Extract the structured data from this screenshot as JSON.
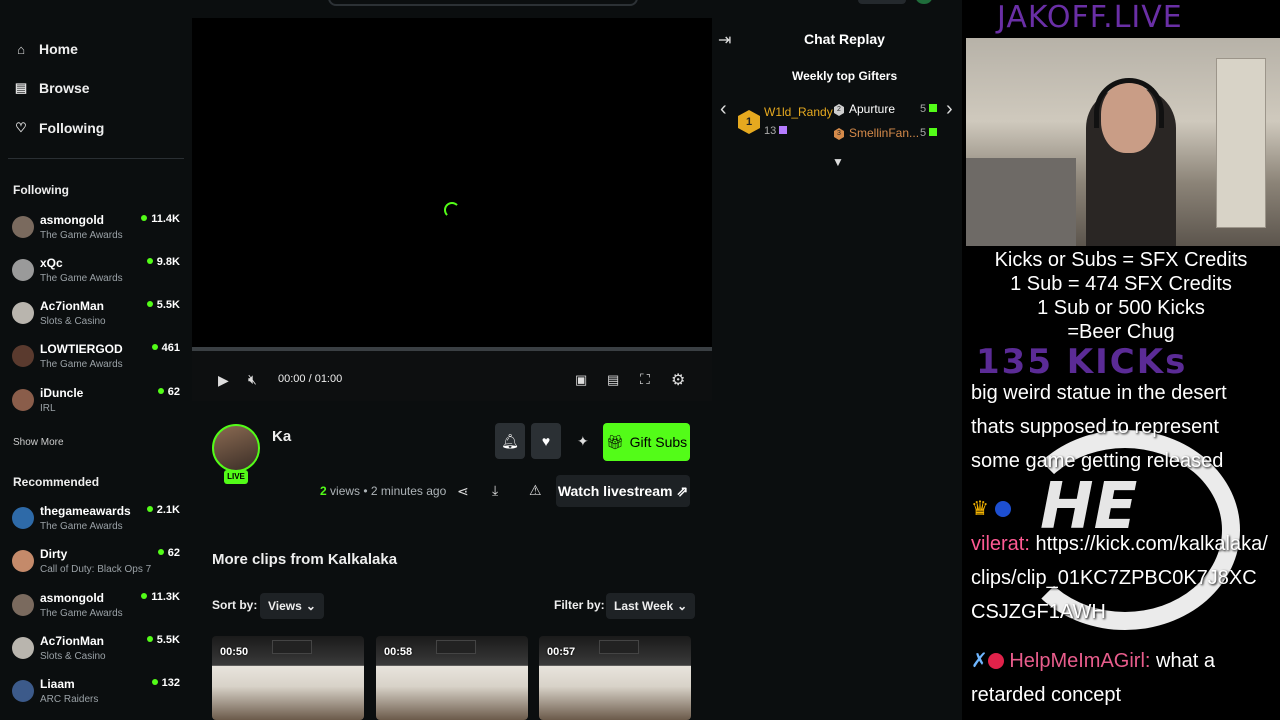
{
  "nav": [
    {
      "icon": "home-icon",
      "glyph": "⌂",
      "label": "Home"
    },
    {
      "icon": "browse-icon",
      "glyph": "▤",
      "label": "Browse"
    },
    {
      "icon": "heart-icon",
      "glyph": "♡",
      "label": "Following"
    }
  ],
  "sidebar": {
    "following_heading": "Following",
    "following": [
      {
        "name": "asmongold",
        "category": "The Game Awards",
        "viewers": "11.4K"
      },
      {
        "name": "xQc",
        "category": "The Game Awards",
        "viewers": "9.8K"
      },
      {
        "name": "Ac7ionMan",
        "category": "Slots & Casino",
        "viewers": "5.5K"
      },
      {
        "name": "LOWTIERGOD",
        "category": "The Game Awards",
        "viewers": "461"
      },
      {
        "name": "iDuncle",
        "category": "IRL",
        "viewers": "62"
      }
    ],
    "show_more": "Show More",
    "recommended_heading": "Recommended",
    "recommended": [
      {
        "name": "thegameawards",
        "category": "The Game Awards",
        "viewers": "2.1K"
      },
      {
        "name": "Dirty",
        "category": "Call of Duty: Black Ops 7",
        "viewers": "62"
      },
      {
        "name": "asmongold",
        "category": "The Game Awards",
        "viewers": "11.3K"
      },
      {
        "name": "Ac7ionMan",
        "category": "Slots & Casino",
        "viewers": "5.5K"
      },
      {
        "name": "Liaam",
        "category": "ARC Raiders",
        "viewers": "132"
      }
    ]
  },
  "player": {
    "time": "00:00 / 01:00",
    "progress": 0
  },
  "clip": {
    "title_partial": "Ka",
    "live_label": "LIVE",
    "views_count": "2",
    "views_rest": " views • 2 minutes ago",
    "gift_label": "Gift Subs",
    "watch_label": "Watch livestream"
  },
  "more_clips": {
    "title": "More clips from Kalkalaka",
    "sort_label": "Sort by:",
    "sort_value": "Views",
    "filter_label": "Filter by:",
    "filter_value": "Last Week",
    "thumbs": [
      {
        "duration": "00:50"
      },
      {
        "duration": "00:58"
      },
      {
        "duration": "00:57"
      }
    ]
  },
  "chat": {
    "title": "Chat Replay",
    "gifters_title": "Weekly top Gifters",
    "top_gifter": {
      "rank": "1",
      "name": "W1ld_Randy",
      "count": "13"
    },
    "gifters": [
      {
        "name": "Apurture",
        "count": "5"
      },
      {
        "name": "SmellinFan...",
        "count": "5"
      }
    ]
  },
  "overlay": {
    "title": "JAKOFF.LIVE",
    "lines": [
      "Kicks or Subs = SFX Credits",
      "1 Sub = 474 SFX Credits",
      "1 Sub or 500 Kicks",
      "=Beer Chug"
    ],
    "kicks": "135 KICKs",
    "msg1": "big weird statue in the desert thats supposed to represent some game getting released",
    "msg2_user": "vilerat:",
    "msg2_text": " https://kick.com/kalkalaka/clips/clip_01KC7ZPBC0K7J8XCCSJZGF1AWH",
    "msg3_user": "HelpMeImAGirl:",
    "msg3_text": " what a retarded concept"
  }
}
